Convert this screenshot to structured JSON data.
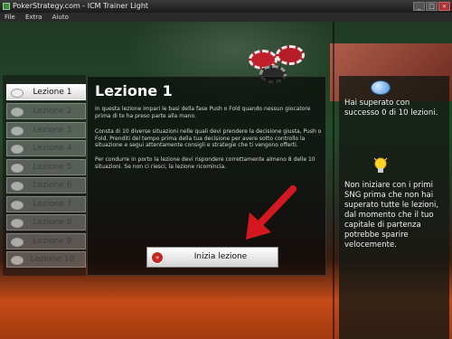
{
  "window": {
    "title": "PokerStrategy.com - ICM Trainer Light"
  },
  "menu": [
    "File",
    "Extra",
    "Aiuto"
  ],
  "lessons": [
    {
      "label": "Lezione 1",
      "active": true
    },
    {
      "label": "Lezione 2",
      "active": false
    },
    {
      "label": "Lezione 3",
      "active": false
    },
    {
      "label": "Lezione 4",
      "active": false
    },
    {
      "label": "Lezione 5",
      "active": false
    },
    {
      "label": "Lezione 6",
      "active": false
    },
    {
      "label": "Lezione 7",
      "active": false
    },
    {
      "label": "Lezione 8",
      "active": false
    },
    {
      "label": "Lezione 9",
      "active": false
    },
    {
      "label": "Lezione 10",
      "active": false
    }
  ],
  "main": {
    "title": "Lezione 1",
    "paragraphs": [
      "In questa lezione impari le basi della fase Push o Fold quando nessun giocatore prima di te ha preso parte alla mano.",
      "Consta di 10 diverse situazioni nelle quali devi prendere la decisione giusta, Push o Fold. Prenditi del tempo prima della tua decisione per avere sotto controllo la situazione e segui attentamente consigli e strategie che ti vengono offerti.",
      "Per condurre in porto la lezione devi rispondere correttamente almeno 8 delle 10 situazioni. Se non ci riesci, la lezione ricomincia."
    ],
    "start_button": "Inizia lezione"
  },
  "right": {
    "status": "Hai superato con successo 0 di 10 lezioni.",
    "tip": "Non iniziare con i primi SNG prima che non hai superato tutte le lezioni, dal momento che il tuo capitale di partenza potrebbe sparire velocemente."
  },
  "icons": {
    "window_buttons": [
      "minimize-icon",
      "maximize-icon",
      "close-icon"
    ],
    "start": "play-icon",
    "status": "speech-bubble-icon",
    "tip": "lightbulb-icon"
  },
  "colors": {
    "accent_red": "#c52820",
    "arrow_red": "#d4181f"
  }
}
